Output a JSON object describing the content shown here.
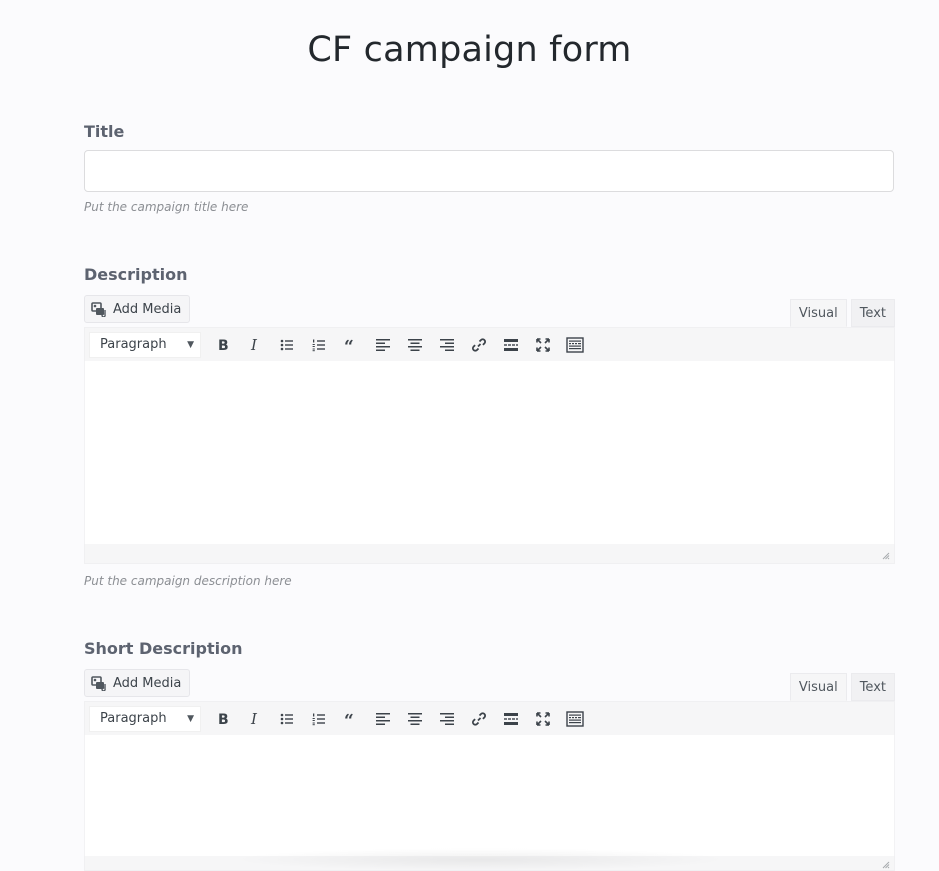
{
  "page": {
    "title": "CF campaign form"
  },
  "title_field": {
    "label": "Title",
    "value": "",
    "placeholder": "",
    "help": "Put the campaign title here"
  },
  "description_field": {
    "label": "Description",
    "add_media": "Add Media",
    "tabs": {
      "visual": "Visual",
      "text": "Text"
    },
    "format": "Paragraph",
    "help": "Put the campaign description here"
  },
  "short_description_field": {
    "label": "Short Description",
    "add_media": "Add Media",
    "tabs": {
      "visual": "Visual",
      "text": "Text"
    },
    "format": "Paragraph"
  },
  "toolbar_icons": [
    "bold-icon",
    "italic-icon",
    "bullet-list-icon",
    "numbered-list-icon",
    "blockquote-icon",
    "align-left-icon",
    "align-center-icon",
    "align-right-icon",
    "link-icon",
    "read-more-icon",
    "fullscreen-icon",
    "toolbar-toggle-icon"
  ]
}
